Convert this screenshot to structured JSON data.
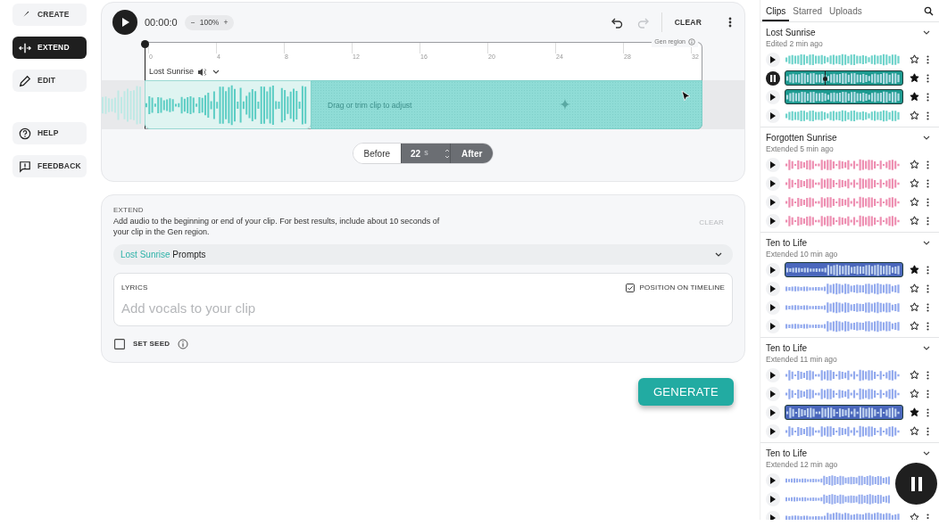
{
  "nav": {
    "modes": [
      {
        "kind": "create",
        "label": "CREATE",
        "selected": false
      },
      {
        "kind": "extend",
        "label": "EXTEND",
        "selected": true
      },
      {
        "kind": "edit",
        "label": "EDIT",
        "selected": false
      }
    ],
    "support": [
      {
        "kind": "help",
        "label": "HELP"
      },
      {
        "kind": "feedback",
        "label": "FEEDBACK"
      }
    ]
  },
  "transport": {
    "playing": false,
    "time": "00:00:0",
    "zoom_out": "−",
    "zoom": "100%",
    "zoom_in": "+",
    "redo_disabled": true,
    "clear": "CLEAR"
  },
  "timeline": {
    "ticks": [
      "0",
      "4",
      "8",
      "12",
      "16",
      "20",
      "24",
      "28",
      "32"
    ],
    "gen_region": "Gen region",
    "clip_name": "Lost Sunrise",
    "hint": "Drag or trim clip to adjust"
  },
  "duration": {
    "options": [
      {
        "label": "Before",
        "selected": false
      },
      {
        "label": "After",
        "selected": true
      }
    ],
    "value": "22",
    "unit": "s"
  },
  "extend": {
    "title": "EXTEND",
    "description": "Add audio to the beginning or end of your clip. For best results, include about 10 seconds of your clip in the Gen region.",
    "clear": "CLEAR",
    "clear_disabled": true,
    "prompt_clip": "Lost Sunrise",
    "prompt_label": "Prompts",
    "lyrics_label": "LYRICS",
    "position_label": "POSITION ON TIMELINE",
    "position_checked": true,
    "lyrics_placeholder": "Add vocals to your clip",
    "seed_label": "SET SEED",
    "seed_checked": false
  },
  "generate": "GENERATE",
  "sidebar": {
    "tabs": [
      {
        "label": "Clips",
        "selected": true
      },
      {
        "label": "Starred",
        "selected": false
      },
      {
        "label": "Uploads",
        "selected": false
      }
    ],
    "groups": [
      {
        "title": "Lost Sunrise",
        "subtitle": "Edited 2 min ago",
        "color": "#6fd3cb",
        "expanded": true,
        "clips": [
          {
            "playing": false,
            "selected": false,
            "starred": false
          },
          {
            "playing": true,
            "selected": true,
            "starred": true
          },
          {
            "playing": false,
            "selected": true,
            "starred": true
          },
          {
            "playing": false,
            "selected": false,
            "starred": false
          }
        ]
      },
      {
        "title": "Forgotten Sunrise",
        "subtitle": "Extended 5 min ago",
        "color": "#ee8fb2",
        "expanded": true,
        "clips": [
          {
            "playing": false,
            "selected": false,
            "starred": false
          },
          {
            "playing": false,
            "selected": false,
            "starred": false
          },
          {
            "playing": false,
            "selected": false,
            "starred": false
          },
          {
            "playing": false,
            "selected": false,
            "starred": false
          }
        ]
      },
      {
        "title": "Ten to Life",
        "subtitle": "Extended 10 min ago",
        "color": "#93aaee",
        "expanded": true,
        "clips": [
          {
            "playing": false,
            "selected": true,
            "starred": true
          },
          {
            "playing": false,
            "selected": false,
            "starred": false
          },
          {
            "playing": false,
            "selected": false,
            "starred": false
          },
          {
            "playing": false,
            "selected": false,
            "starred": false
          }
        ]
      },
      {
        "title": "Ten to Life",
        "subtitle": "Extended 11 min ago",
        "color": "#93aaee",
        "expanded": true,
        "clips": [
          {
            "playing": false,
            "selected": false,
            "starred": false
          },
          {
            "playing": false,
            "selected": false,
            "starred": false
          },
          {
            "playing": false,
            "selected": true,
            "starred": true
          },
          {
            "playing": false,
            "selected": false,
            "starred": false
          }
        ]
      },
      {
        "title": "Ten to Life",
        "subtitle": "Extended 12 min ago",
        "color": "#93aaee",
        "expanded": true,
        "clips": [
          {
            "playing": false,
            "selected": false
          },
          {
            "playing": false,
            "selected": false
          },
          {
            "playing": false,
            "selected": false,
            "starred": false
          }
        ]
      }
    ]
  },
  "floating_player": {
    "playing": true
  }
}
